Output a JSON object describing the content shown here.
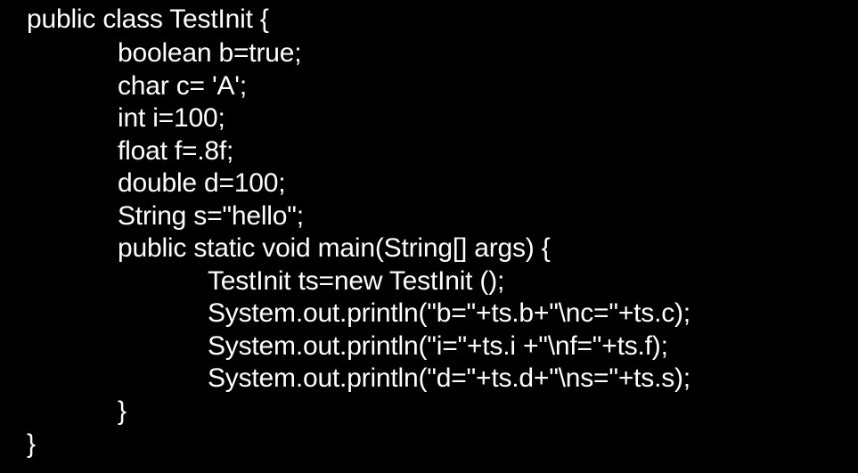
{
  "code": {
    "lines": [
      "public class TestInit {",
      "boolean b=true;",
      "char c= 'A';",
      "int i=100;",
      "float f=.8f;",
      "double d=100;",
      "String s=\"hello\";",
      "public static void main(String[] args) {",
      "TestInit ts=new TestInit ();",
      "System.out.println(\"b=\"+ts.b+\"\\nc=\"+ts.c);",
      "System.out.println(\"i=\"+ts.i +\"\\nf=\"+ts.f);",
      "System.out.println(\"d=\"+ts.d+\"\\ns=\"+ts.s);",
      "}",
      "}"
    ]
  },
  "colors": {
    "background": "#000000",
    "text": "#ffffff"
  }
}
